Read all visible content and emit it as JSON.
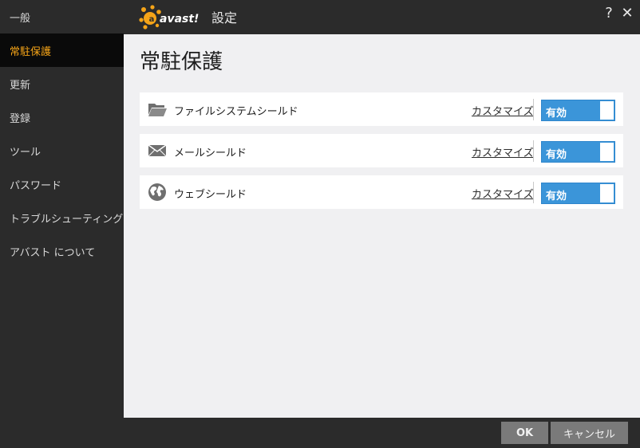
{
  "window": {
    "brand": "avast!",
    "title": "設定",
    "help_glyph": "?",
    "close_glyph": "✕"
  },
  "sidebar": {
    "items": [
      {
        "label": "一般"
      },
      {
        "label": "常駐保護",
        "active": true
      },
      {
        "label": "更新"
      },
      {
        "label": "登録"
      },
      {
        "label": "ツール"
      },
      {
        "label": "パスワード"
      },
      {
        "label": "トラブルシューティング"
      },
      {
        "label": "アバスト について"
      }
    ]
  },
  "main": {
    "title": "常駐保護",
    "shields": [
      {
        "name": "ファイルシステムシールド",
        "icon": "folder-icon",
        "customize": "カスタマイズ",
        "state": "有効"
      },
      {
        "name": "メールシールド",
        "icon": "mail-icon",
        "customize": "カスタマイズ",
        "state": "有効"
      },
      {
        "name": "ウェブシールド",
        "icon": "globe-icon",
        "customize": "カスタマイズ",
        "state": "有効"
      }
    ]
  },
  "footer": {
    "ok_label": "OK",
    "cancel_label": "キャンセル"
  },
  "colors": {
    "accent": "#f5a418",
    "toggle_on": "#3b95d9",
    "sidebar_bg": "#2b2b2b",
    "active_bg": "#0a0a0a",
    "content_bg": "#f0f0f2"
  }
}
